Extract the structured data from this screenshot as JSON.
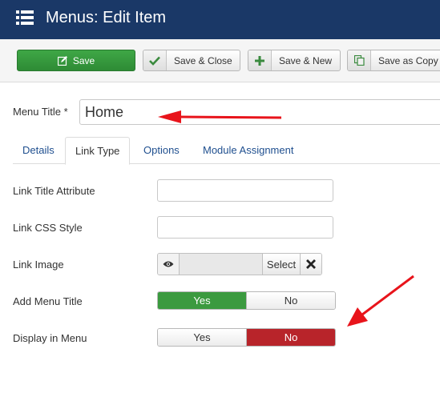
{
  "header": {
    "title": "Menus: Edit Item",
    "icon": "list-icon"
  },
  "toolbar": {
    "save": {
      "label": "Save",
      "icon": "edit-icon"
    },
    "save_close": {
      "label": "Save & Close",
      "icon": "check-icon"
    },
    "save_new": {
      "label": "Save & New",
      "icon": "plus-icon"
    },
    "save_copy": {
      "label": "Save as Copy",
      "icon": "copy-icon"
    }
  },
  "menu_title": {
    "label": "Menu Title *",
    "value": "Home"
  },
  "tabs": [
    {
      "label": "Details",
      "active": false
    },
    {
      "label": "Link Type",
      "active": true
    },
    {
      "label": "Options",
      "active": false
    },
    {
      "label": "Module Assignment",
      "active": false
    }
  ],
  "fields": {
    "link_title_attribute": {
      "label": "Link Title Attribute",
      "value": ""
    },
    "link_css_style": {
      "label": "Link CSS Style",
      "value": ""
    },
    "link_image": {
      "label": "Link Image",
      "select_label": "Select",
      "preview_icon": "eye-icon",
      "clear_icon": "close-icon"
    },
    "add_menu_title": {
      "label": "Add Menu Title",
      "yes": "Yes",
      "no": "No",
      "selected": "Yes"
    },
    "display_in_menu": {
      "label": "Display in Menu",
      "yes": "Yes",
      "no": "No",
      "selected": "No"
    }
  },
  "colors": {
    "header_bg": "#1a3867",
    "save_green": "#2e8b35",
    "toggle_yes": "#3b9a3f",
    "toggle_no": "#b8242a",
    "annotation_red": "#e8141b"
  }
}
